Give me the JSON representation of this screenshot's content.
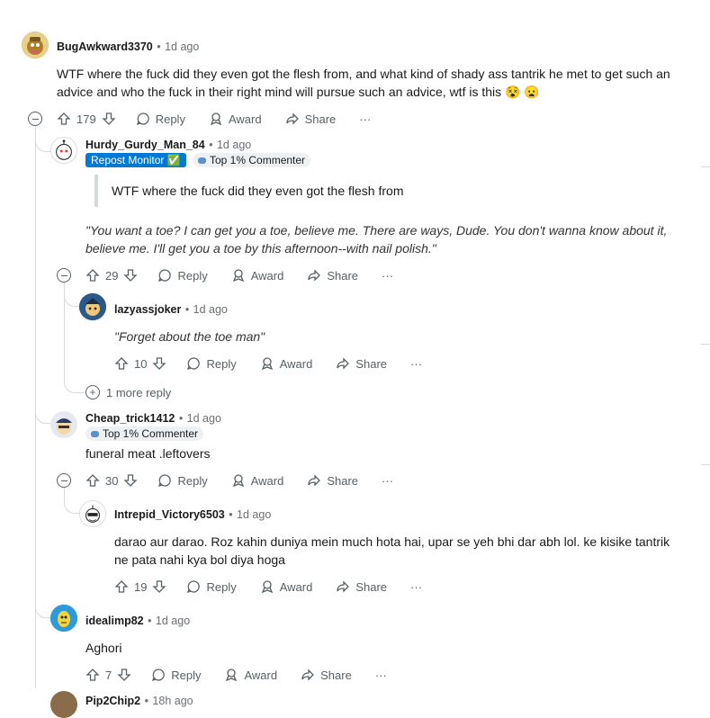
{
  "comments": [
    {
      "user": "BugAwkward3370",
      "time": "1d ago",
      "text": "WTF where the fuck did they even got the flesh from, and what kind of shady ass tantrik he met to get such an advice and who the fuck in their right mind will pursue such an advice, wtf is this",
      "votes": "179"
    },
    {
      "user": "Hurdy_Gurdy_Man_84",
      "time": "1d ago",
      "badge1": "Repost Monitor ✅",
      "badge2": "Top 1% Commenter",
      "quote": "WTF where the fuck did they even got the flesh from",
      "text": "\"You want a toe? I can get you a toe, believe me. There are ways, Dude. You don't wanna know about it, believe me. I'll get you a toe by this afternoon--with nail polish.\"",
      "votes": "29"
    },
    {
      "user": "lazyassjoker",
      "time": "1d ago",
      "text": "\"Forget about the toe man\"",
      "votes": "10"
    },
    {
      "user": "Cheap_trick1412",
      "time": "1d ago",
      "badge2": "Top 1% Commenter",
      "text": "funeral meat .leftovers",
      "votes": "30"
    },
    {
      "user": "Intrepid_Victory6503",
      "time": "1d ago",
      "text": "darao aur darao. Roz kahin duniya mein much hota hai, upar se yeh bhi dar abh lol. ke kisike tantrik ne pata nahi kya bol diya hoga",
      "votes": "19"
    },
    {
      "user": "idealimp82",
      "time": "1d ago",
      "text": "Aghori",
      "votes": "7"
    },
    {
      "user": "Pip2Chip2",
      "time": "18h ago"
    }
  ],
  "actions": {
    "reply": "Reply",
    "award": "Award",
    "share": "Share",
    "more": "···"
  },
  "more_replies": "1 more reply",
  "sep": "•",
  "colors": {
    "accent": "#0079d3",
    "line": "#d7dadc",
    "muted": "#576064"
  }
}
